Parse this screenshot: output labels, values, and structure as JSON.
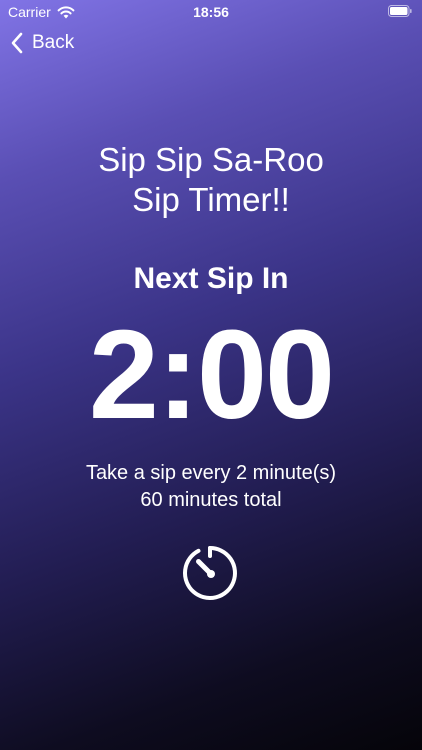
{
  "status_bar": {
    "carrier": "Carrier",
    "time": "18:56",
    "wifi_icon": "wifi-icon",
    "battery_icon": "battery-icon"
  },
  "nav": {
    "back_label": "Back",
    "back_icon": "chevron-left-icon"
  },
  "title": {
    "line1": "Sip Sip Sa-Roo",
    "line2": "Sip Timer!!"
  },
  "timer": {
    "label": "Next Sip In",
    "countdown": "2:00",
    "interval_text": "Take a sip every 2 minute(s)",
    "total_text": "60 minutes total",
    "action_icon": "timer-icon"
  },
  "colors": {
    "gradient_top": "#8174e6",
    "gradient_bottom": "#050409",
    "text": "#ffffff"
  }
}
